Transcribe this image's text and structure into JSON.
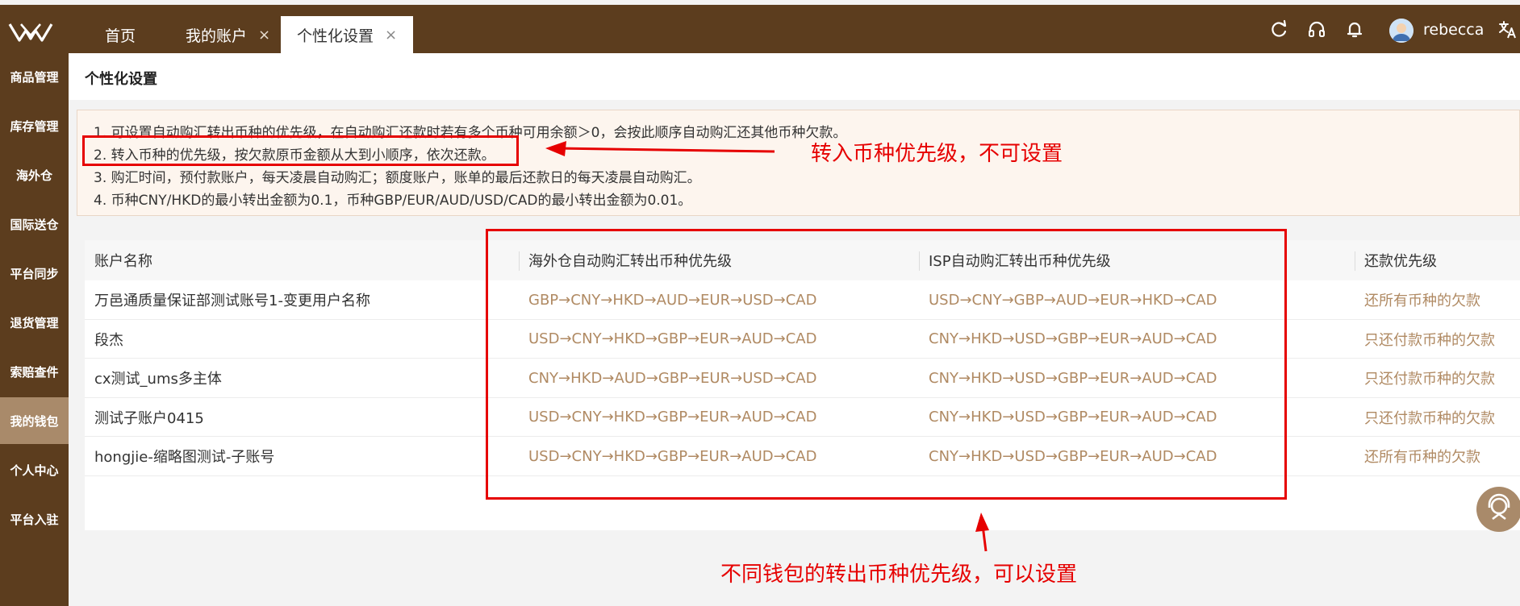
{
  "header": {
    "tabs": [
      {
        "label": "首页",
        "closable": false
      },
      {
        "label": "我的账户",
        "closable": true
      },
      {
        "label": "个性化设置",
        "closable": true
      }
    ],
    "close_glyph": "×",
    "username": "rebecca"
  },
  "sidebar": {
    "items": [
      {
        "label": "商品管理"
      },
      {
        "label": "库存管理"
      },
      {
        "label": "海外仓"
      },
      {
        "label": "国际送仓"
      },
      {
        "label": "平台同步"
      },
      {
        "label": "退货管理"
      },
      {
        "label": "索赔查件"
      },
      {
        "label": "我的钱包"
      },
      {
        "label": "个人中心"
      },
      {
        "label": "平台入驻"
      }
    ],
    "active_index": 7
  },
  "page": {
    "title": "个性化设置",
    "notices": [
      "1. 可设置自动购汇转出币种的优先级，在自动购汇还款时若有多个币种可用余额＞0，会按此顺序自动购汇还其他币种欠款。",
      "2. 转入币种的优先级，按欠款原币金额从大到小顺序，依次还款。",
      "3. 购汇时间，预付款账户，每天凌晨自动购汇；额度账户，账单的最后还款日的每天凌晨自动购汇。",
      "4. 币种CNY/HKD的最小转出金额为0.1，币种GBP/EUR/AUD/USD/CAD的最小转出金额为0.01。"
    ]
  },
  "table": {
    "headers": [
      "账户名称",
      "海外仓自动购汇转出币种优先级",
      "ISP自动购汇转出币种优先级",
      "还款优先级"
    ],
    "rows": [
      {
        "name": "万邑通质量保证部测试账号1-变更用户名称",
        "overseas": "GBP→CNY→HKD→AUD→EUR→USD→CAD",
        "isp": "USD→CNY→GBP→AUD→EUR→HKD→CAD",
        "repay": "还所有币种的欠款"
      },
      {
        "name": "段杰",
        "overseas": "USD→CNY→HKD→GBP→EUR→AUD→CAD",
        "isp": "CNY→HKD→USD→GBP→EUR→AUD→CAD",
        "repay": "只还付款币种的欠款"
      },
      {
        "name": "cx测试_ums多主体",
        "overseas": "CNY→HKD→AUD→GBP→EUR→USD→CAD",
        "isp": "CNY→HKD→USD→GBP→EUR→AUD→CAD",
        "repay": "只还付款币种的欠款"
      },
      {
        "name": "测试子账户0415",
        "overseas": "USD→CNY→HKD→GBP→EUR→AUD→CAD",
        "isp": "CNY→HKD→USD→GBP→EUR→AUD→CAD",
        "repay": "只还付款币种的欠款"
      },
      {
        "name": "hongjie-缩略图测试-子账号",
        "overseas": "USD→CNY→HKD→GBP→EUR→AUD→CAD",
        "isp": "CNY→HKD→USD→GBP→EUR→AUD→CAD",
        "repay": "还所有币种的欠款"
      }
    ]
  },
  "annotations": {
    "note_top": "转入币种优先级，不可设置",
    "note_bottom": "不同钱包的转出币种优先级，可以设置"
  },
  "icons": [
    "logo-icon",
    "refresh-icon",
    "headset-icon",
    "bell-icon",
    "avatar",
    "translate-icon",
    "customer-service-icon"
  ],
  "colors": {
    "brand": "#5c3d1e",
    "sidebar_active": "#a98a6a",
    "currency_text": "#b08a63",
    "annotation": "#e60000"
  }
}
